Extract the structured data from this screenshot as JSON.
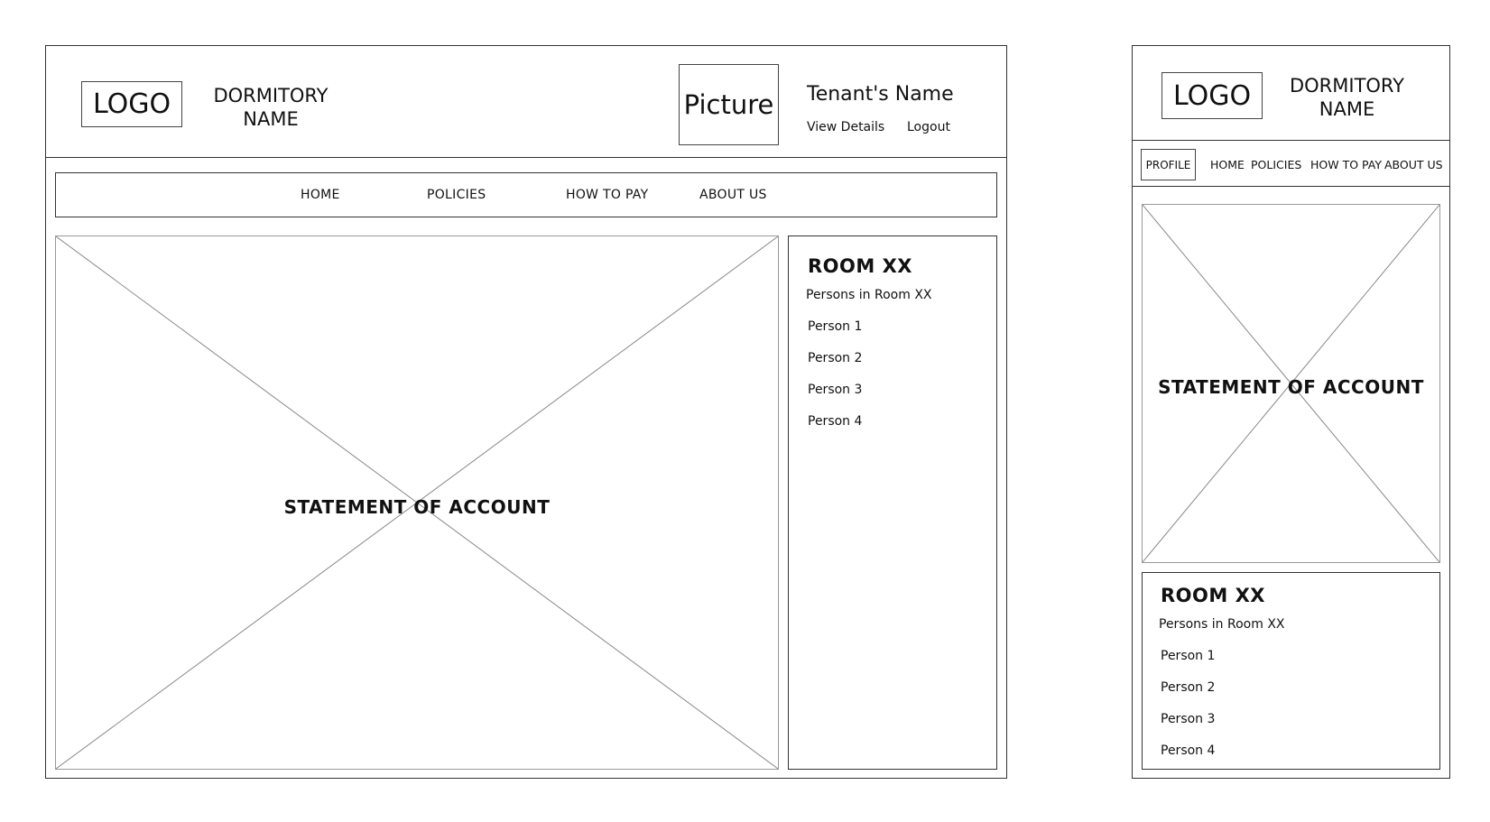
{
  "desktop": {
    "header": {
      "logo": "LOGO",
      "dormitory_name_line1": "DORMITORY",
      "dormitory_name_line2": "NAME",
      "picture": "Picture",
      "tenant_name": "Tenant's Name",
      "view_details": "View Details",
      "logout": "Logout"
    },
    "nav": {
      "items": [
        {
          "label": "HOME"
        },
        {
          "label": "POLICIES"
        },
        {
          "label": "HOW TO PAY"
        },
        {
          "label": "ABOUT US"
        }
      ]
    },
    "main": {
      "statement_label": "STATEMENT OF ACCOUNT"
    },
    "room_panel": {
      "title": "ROOM XX",
      "subtitle": "Persons in Room XX",
      "persons": [
        "Person 1",
        "Person 2",
        "Person 3",
        "Person 4"
      ]
    }
  },
  "mobile": {
    "header": {
      "logo": "LOGO",
      "dormitory_name_line1": "DORMITORY",
      "dormitory_name_line2": "NAME"
    },
    "nav": {
      "profile": "PROFILE",
      "items": [
        {
          "label": "HOME"
        },
        {
          "label": "POLICIES"
        },
        {
          "label": "HOW TO PAY"
        },
        {
          "label": "ABOUT US"
        }
      ]
    },
    "main": {
      "statement_label": "STATEMENT OF ACCOUNT"
    },
    "room_panel": {
      "title": "ROOM XX",
      "subtitle": "Persons in Room XX",
      "persons": [
        "Person 1",
        "Person 2",
        "Person 3",
        "Person 4"
      ]
    }
  }
}
